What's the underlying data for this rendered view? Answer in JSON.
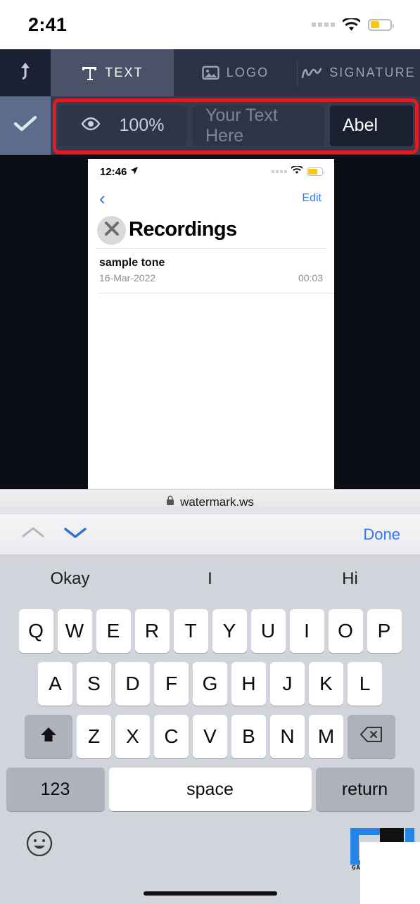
{
  "status_bar": {
    "time": "2:41",
    "wifi_icon": "wifi-icon",
    "battery_icon": "battery-icon",
    "signal_icon": "signal-dots-icon"
  },
  "tab_bar": {
    "upload_icon": "upload-arrow-icon",
    "tabs": [
      {
        "label": "TEXT",
        "icon": "text-t-icon",
        "active": true
      },
      {
        "label": "LOGO",
        "icon": "image-icon",
        "active": false
      },
      {
        "label": "SIGNATURE",
        "icon": "signature-squiggle-icon",
        "active": false
      }
    ]
  },
  "control_bar": {
    "confirm_icon": "checkmark-icon",
    "opacity": {
      "icon": "eye-icon",
      "value": "100%"
    },
    "text_field": {
      "value": "",
      "placeholder": "Your Text Here"
    },
    "font_button": {
      "label": "Abel"
    },
    "highlight_color": "#e01b22"
  },
  "preview": {
    "close_icon": "close-x-icon",
    "document": {
      "status_time": "12:46",
      "location_icon": "location-arrow-icon",
      "back_icon": "chevron-left-icon",
      "edit_label": "Edit",
      "title": "Recordings",
      "rows": [
        {
          "name": "sample tone",
          "date": "16-Mar-2022",
          "duration": "00:03"
        }
      ]
    }
  },
  "browser_bar": {
    "lock_icon": "lock-icon",
    "url": "watermark.ws"
  },
  "accessory_bar": {
    "prev_icon": "chevron-up-icon",
    "next_icon": "chevron-down-icon",
    "done_label": "Done"
  },
  "suggestions": [
    "Okay",
    "I",
    "Hi"
  ],
  "keyboard": {
    "row1": [
      "Q",
      "W",
      "E",
      "R",
      "T",
      "Y",
      "U",
      "I",
      "O",
      "P"
    ],
    "row2": [
      "A",
      "S",
      "D",
      "F",
      "G",
      "H",
      "J",
      "K",
      "L"
    ],
    "row3": [
      "Z",
      "X",
      "C",
      "V",
      "B",
      "N",
      "M"
    ],
    "shift_icon": "shift-arrow-icon",
    "backspace_icon": "backspace-icon",
    "numbers_label": "123",
    "space_label": "space",
    "return_label": "return",
    "emoji_icon": "emoji-smiley-icon"
  },
  "watermark": {
    "text": "GAD"
  }
}
